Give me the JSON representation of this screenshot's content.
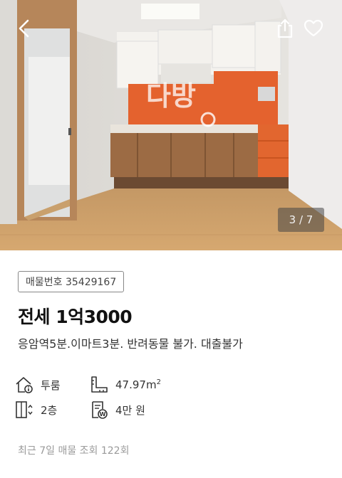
{
  "gallery": {
    "counter": "3 / 7",
    "back_icon": "chevron-left-icon",
    "share_icon": "share-icon",
    "like_icon": "heart-icon"
  },
  "listing": {
    "number_label": "매물번호 35429167",
    "price": "전세 1억3000",
    "description": "응암역5분.이마트3분. 반려동물 불가. 대출불가"
  },
  "specs": {
    "rooms": "투룸",
    "area_value": "47.97m",
    "area_sup": "2",
    "floor": "2층",
    "maintenance_fee": "4만 원"
  },
  "stats": {
    "views": "최근 7일 매물 조회 122회"
  },
  "colors": {
    "backsplash_orange": "#e4622e",
    "cabinet_wood": "#9c6b44",
    "floor_wood": "#c99a63"
  }
}
